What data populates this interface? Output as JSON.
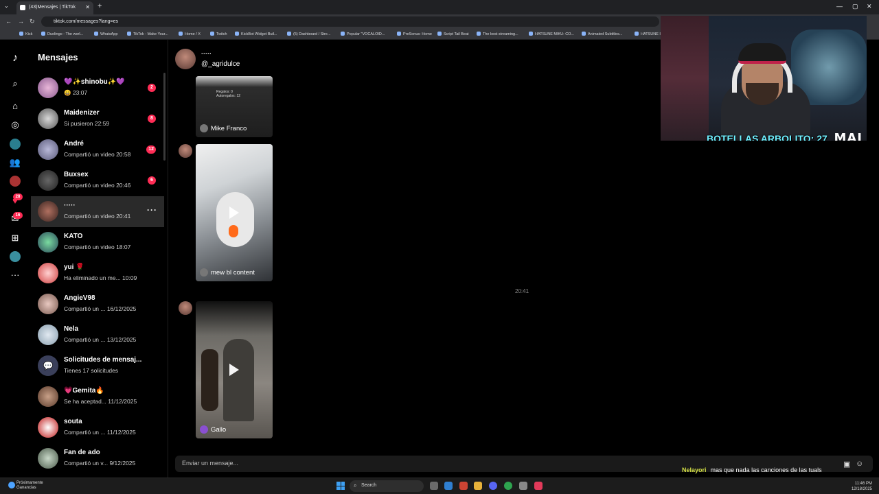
{
  "browser": {
    "tab_title": "(43)Mensajes | TikTok",
    "url": "tiktok.com/messages?lang=es",
    "bookmarks": [
      "Kick",
      "Duolingo - The worl...",
      "WhatsApp",
      "TikTok - Make Your...",
      "Home / X",
      "Twitch",
      "KickBot Widget Buil...",
      "(5) Dashboard / Stre...",
      "Popular \"VOCALOID...",
      "PreSonus: Home",
      "Script Tail Beat",
      "The best streaming...",
      "HATSUNE MIKU: CO...",
      "Animated Subtitles...",
      "HATSUNE I"
    ]
  },
  "rail": {
    "badge_gifts": "28",
    "badge_inbox": "16"
  },
  "sidebar": {
    "title": "Mensajes",
    "conversations": [
      {
        "name": "💜✨shinobu✨💜",
        "preview": "😄 23:07",
        "badge": "2"
      },
      {
        "name": "Maidenizer",
        "preview": "Si pusieron 22:59",
        "badge": "8"
      },
      {
        "name": "André",
        "preview": "Compartió un video 20:58",
        "badge": "12"
      },
      {
        "name": "Buxsex",
        "preview": "Compartió un video 20:46",
        "badge": "6"
      },
      {
        "name": "·····",
        "preview": "Compartió un video 20:41",
        "badge": ""
      },
      {
        "name": "KATO",
        "preview": "Compartió un video 18:07",
        "badge": ""
      },
      {
        "name": "yui 🌹",
        "preview": "Ha eliminado un me...  10:09",
        "badge": ""
      },
      {
        "name": "AngieV98",
        "preview": "Compartió un ...  16/12/2025",
        "badge": ""
      },
      {
        "name": "Nela",
        "preview": "Compartió un ...  13/12/2025",
        "badge": ""
      },
      {
        "name": "Solicitudes de mensaj...",
        "preview": "Tienes 17 solicitudes",
        "badge": ""
      },
      {
        "name": "💗Gemita🔥",
        "preview": "Se ha aceptad...  11/12/2025",
        "badge": ""
      },
      {
        "name": "souta",
        "preview": "Compartió un ...  11/12/2025",
        "badge": ""
      },
      {
        "name": "Fan de ado",
        "preview": "Compartió un v...  9/12/2025",
        "badge": ""
      }
    ],
    "more_label": "···"
  },
  "chat": {
    "header_name": "·····",
    "header_user": "@_agridulce",
    "videos": [
      {
        "author": "Mike Franco",
        "overlay": "Regalos: 0\nAutoregalos: 12"
      },
      {
        "author": "mew bl content"
      },
      {
        "author": "Gallo"
      }
    ],
    "timestamp": "20:41",
    "input_placeholder": "Enviar un mensaje..."
  },
  "stream": {
    "counter": "BOTELLAS ARBOLITO: 27",
    "logo": "MAI",
    "chat_user": "Nelayori",
    "chat_text": "mas que nada las canciones de las tuals"
  },
  "taskbar": {
    "weather_line1": "Próximamente",
    "weather_line2": "Ganancias",
    "search": "Search",
    "time": "11:46 PM",
    "date": "12/18/2025"
  },
  "colors": {
    "accent": "#fe2c55",
    "counter": "#6ff0ff",
    "chat_user": "#d4e045"
  }
}
